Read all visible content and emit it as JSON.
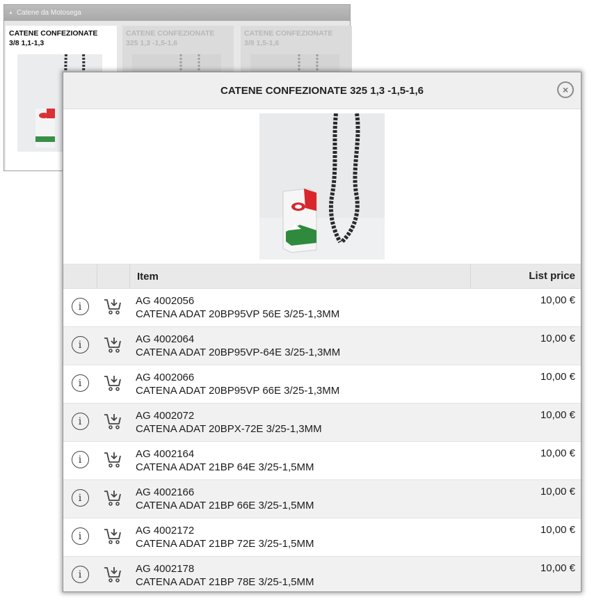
{
  "background_panel": {
    "title": "Catene da Motosega",
    "categories": [
      {
        "label": "CATENE CONFEZIONATE\n3/8 1,1-1,3"
      },
      {
        "label": "CATENE CONFEZIONATE\n325 1,3 -1,5-1,6"
      },
      {
        "label": "CATENE CONFEZIONATE\n3/8 1,5-1,6"
      }
    ]
  },
  "modal": {
    "title": "CATENE CONFEZIONATE 325 1,3 -1,5-1,6",
    "close_glyph": "×",
    "table": {
      "headers": {
        "item": "Item",
        "price": "List price"
      },
      "rows": [
        {
          "code": "AG 4002056",
          "desc": "CATENA ADAT 20BP95VP 56E 3/25-1,3MM",
          "price": "10,00 €"
        },
        {
          "code": "AG 4002064",
          "desc": "CATENA ADAT 20BP95VP-64E 3/25-1,3MM",
          "price": "10,00 €"
        },
        {
          "code": "AG 4002066",
          "desc": "CATENA ADAT 20BP95VP 66E 3/25-1,3MM",
          "price": "10,00 €"
        },
        {
          "code": "AG 4002072",
          "desc": "CATENA ADAT 20BPX-72E 3/25-1,3MM",
          "price": "10,00 €"
        },
        {
          "code": "AG 4002164",
          "desc": "CATENA ADAT 21BP 64E 3/25-1,5MM",
          "price": "10,00 €"
        },
        {
          "code": "AG 4002166",
          "desc": "CATENA ADAT 21BP 66E 3/25-1,5MM",
          "price": "10,00 €"
        },
        {
          "code": "AG 4002172",
          "desc": "CATENA ADAT 21BP 72E 3/25-1,5MM",
          "price": "10,00 €"
        },
        {
          "code": "AG 4002178",
          "desc": "CATENA ADAT 21BP 78E 3/25-1,5MM",
          "price": "10,00 €"
        }
      ]
    }
  },
  "icons": {
    "info": "info-circle-icon",
    "cart": "add-to-cart-icon",
    "close": "close-circle-icon",
    "info_glyph": "i"
  },
  "colors": {
    "box_red": "#d9262b",
    "box_green": "#2f8a3e",
    "chain": "#2b2b2b"
  }
}
